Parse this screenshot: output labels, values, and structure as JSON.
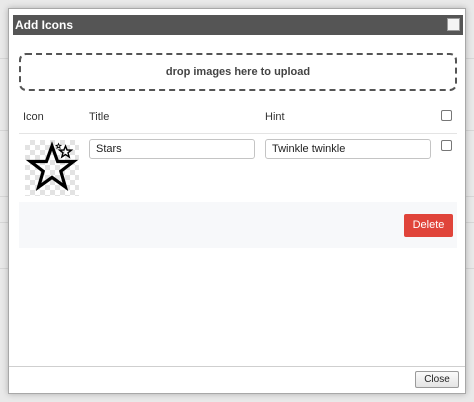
{
  "dialog": {
    "title": "Add Icons",
    "dropzone_text": "drop images here to upload",
    "close_label": "Close"
  },
  "table": {
    "headers": {
      "icon": "Icon",
      "title": "Title",
      "hint": "Hint"
    },
    "rows": [
      {
        "icon": "star-icon",
        "title": "Stars",
        "hint": "Twinkle twinkle",
        "delete_label": "Delete"
      }
    ]
  },
  "colors": {
    "titlebar": "#555555",
    "delete_button": "#e0443a",
    "action_band": "#f7f8fa"
  }
}
